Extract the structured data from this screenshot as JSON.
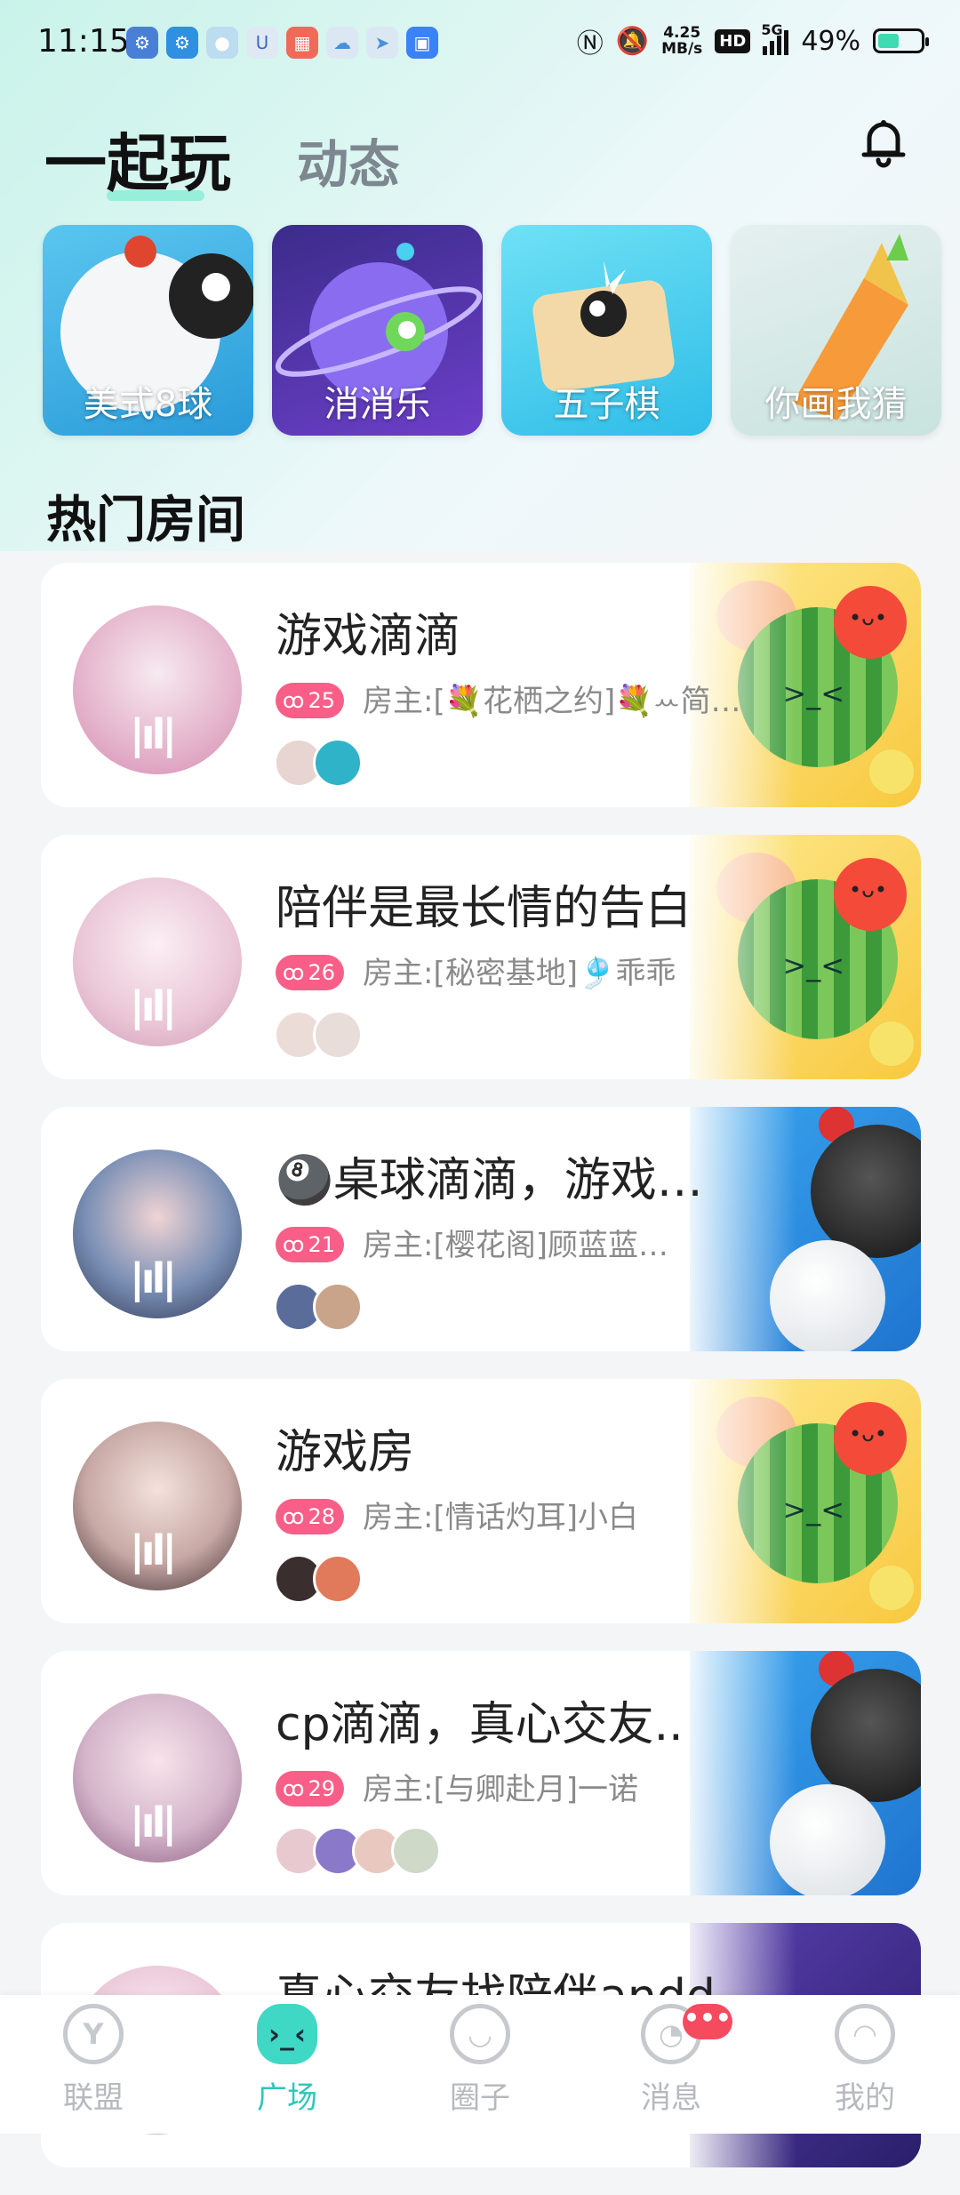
{
  "status_bar": {
    "time": "11:15",
    "net_speed_value": "4.25",
    "net_speed_unit": "MB/s",
    "hd": "HD",
    "network": "5G",
    "battery": "49%",
    "battery_level": 0.49
  },
  "header": {
    "tab_play": "一起玩",
    "tab_feed": "动态"
  },
  "games": [
    {
      "label": "美式8球"
    },
    {
      "label": "消消乐"
    },
    {
      "label": "五子棋"
    },
    {
      "label": "你画我猜"
    }
  ],
  "section_title": "热门房间",
  "rooms": [
    {
      "title": "游戏滴滴",
      "count": "25",
      "host": "房主:[💐花栖之约]💐ꕀ简单✨"
    },
    {
      "title": "陪伴是最长情的告白",
      "count": "26",
      "host": "房主:[秘密基地]🎐乖乖"
    },
    {
      "title": "🎱桌球滴滴，游戏…",
      "count": "21",
      "host": "房主:[樱花阁]顾蓝蓝…"
    },
    {
      "title": "游戏房",
      "count": "28",
      "host": "房主:[情话灼耳]小白"
    },
    {
      "title": "cp滴滴，真心交友..",
      "count": "29",
      "host": "房主:[与卿赴月]一诺"
    },
    {
      "title": "真心交友找陪伴andd"
    }
  ],
  "bottom_nav": [
    {
      "label": "联盟"
    },
    {
      "label": "广场"
    },
    {
      "label": "圈子"
    },
    {
      "label": "消息",
      "badge": "•••"
    },
    {
      "label": "我的"
    }
  ]
}
